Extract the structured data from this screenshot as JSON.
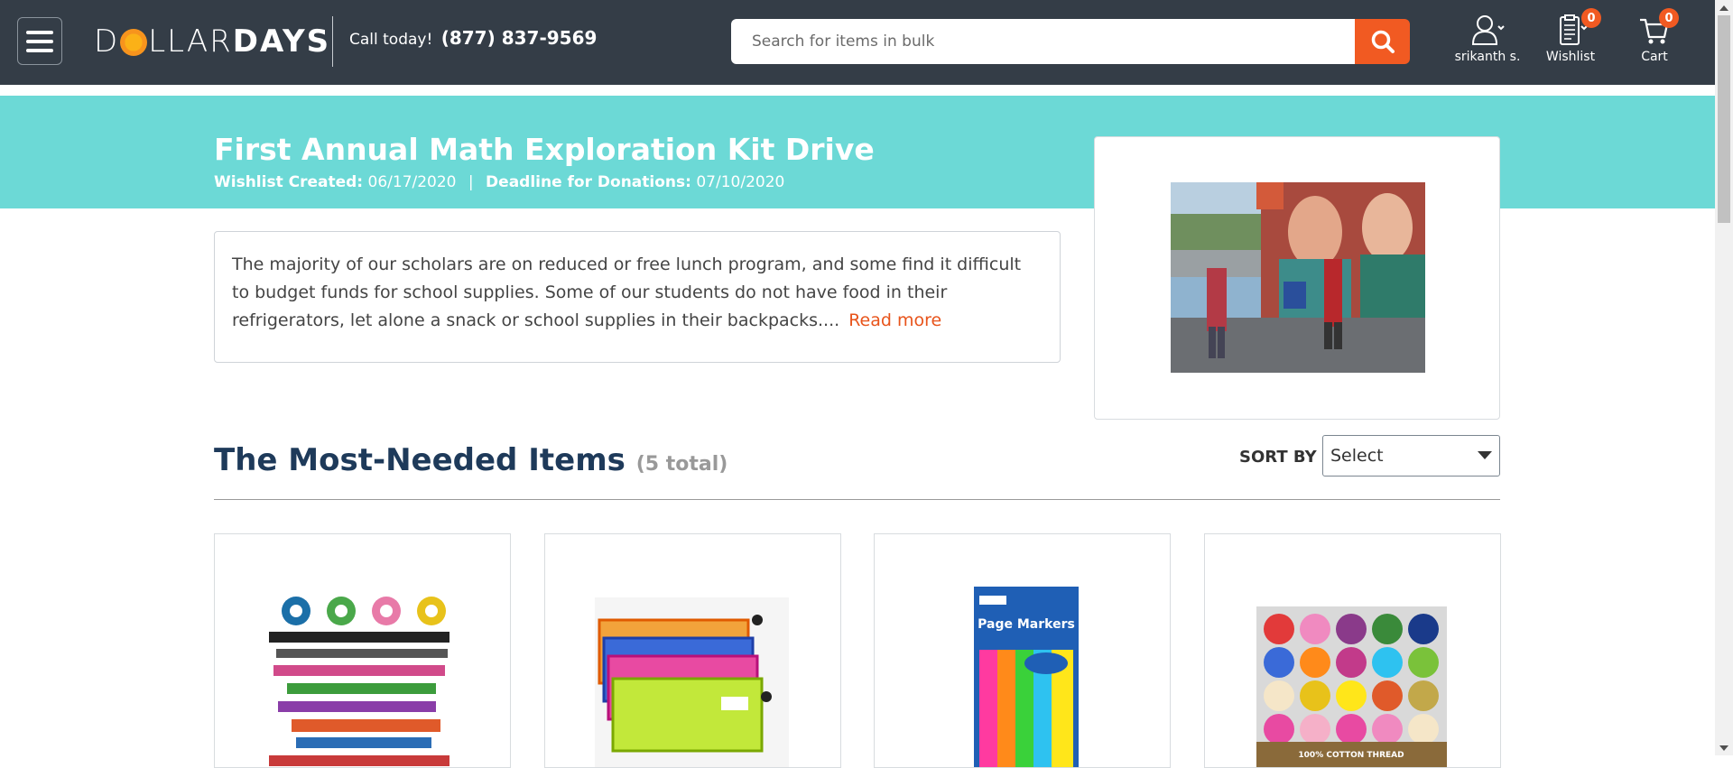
{
  "header": {
    "logo_left": "D",
    "logo_mid": "LLAR",
    "logo_right": "DAYS",
    "call_label": "Call today!",
    "phone": "(877) 837-9569",
    "search_placeholder": "Search for items in bulk",
    "user_label": "srikanth s.",
    "wishlist_label": "Wishlist",
    "wishlist_count": "0",
    "cart_label": "Cart",
    "cart_count": "0"
  },
  "drive": {
    "title": "First Annual Math Exploration Kit Drive",
    "created_label": "Wishlist Created:",
    "created_date": "06/17/2020",
    "separator": "|",
    "deadline_label": "Deadline for Donations:",
    "deadline_date": "07/10/2020",
    "description": "The majority of our scholars are on reduced or free lunch program, and some find it difficult to budget funds for school supplies. Some of our students do not have food in their refrigerators, let alone a snack or school supplies in their backpacks....",
    "read_more": "Read more"
  },
  "items": {
    "heading": "The Most-Needed Items",
    "total": "(5 total)",
    "sort_label": "SORT BY",
    "sort_value": "Select"
  },
  "products": [
    {
      "name": "border-trim"
    },
    {
      "name": "pencil-pouches"
    },
    {
      "name": "page-markers",
      "package_text": "Page Markers"
    },
    {
      "name": "cotton-thread",
      "package_text": "100% COTTON THREAD"
    }
  ],
  "colors": {
    "header_bg": "#343d47",
    "accent": "#f15a22",
    "banner": "#6cd9d6",
    "heading": "#1e3a5a"
  }
}
